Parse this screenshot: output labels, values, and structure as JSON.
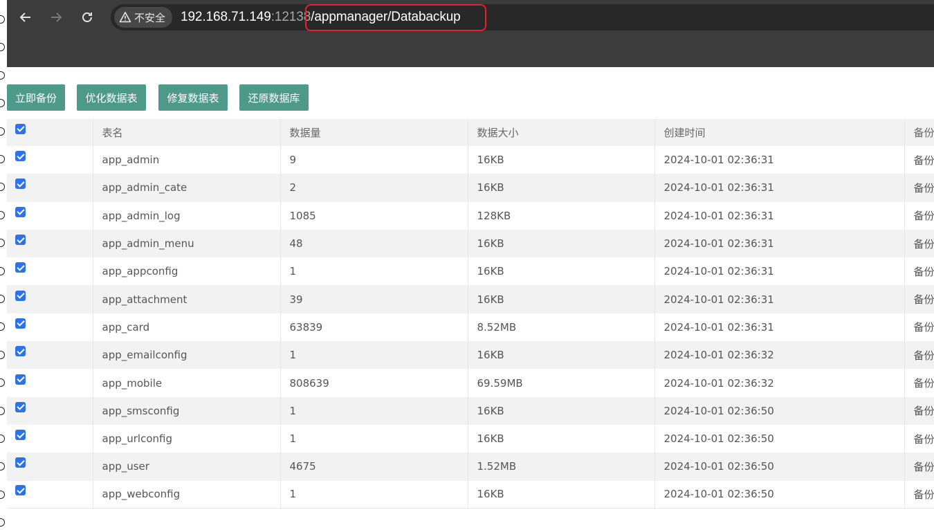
{
  "browser": {
    "security_label": "不安全",
    "url_host": "192.168.71.149",
    "url_port": ":12138",
    "url_path": "/appmanager/Databackup",
    "highlight_color": "#e8202a"
  },
  "actions": {
    "backup_now": "立即备份",
    "optimize_tables": "优化数据表",
    "repair_tables": "修复数据表",
    "restore_database": "还原数据库",
    "button_color": "#4e9a8a"
  },
  "table": {
    "headers": [
      "表名",
      "数据量",
      "数据大小",
      "创建时间",
      "备份"
    ],
    "rows": [
      {
        "name": "app_admin",
        "count": "9",
        "size": "16KB",
        "created": "2024-10-01 02:36:31",
        "op": "备份"
      },
      {
        "name": "app_admin_cate",
        "count": "2",
        "size": "16KB",
        "created": "2024-10-01 02:36:31",
        "op": "备份"
      },
      {
        "name": "app_admin_log",
        "count": "1085",
        "size": "128KB",
        "created": "2024-10-01 02:36:31",
        "op": "备份"
      },
      {
        "name": "app_admin_menu",
        "count": "48",
        "size": "16KB",
        "created": "2024-10-01 02:36:31",
        "op": "备份"
      },
      {
        "name": "app_appconfig",
        "count": "1",
        "size": "16KB",
        "created": "2024-10-01 02:36:31",
        "op": "备份"
      },
      {
        "name": "app_attachment",
        "count": "39",
        "size": "16KB",
        "created": "2024-10-01 02:36:31",
        "op": "备份"
      },
      {
        "name": "app_card",
        "count": "63839",
        "size": "8.52MB",
        "created": "2024-10-01 02:36:31",
        "op": "备份"
      },
      {
        "name": "app_emailconfig",
        "count": "1",
        "size": "16KB",
        "created": "2024-10-01 02:36:32",
        "op": "备份"
      },
      {
        "name": "app_mobile",
        "count": "808639",
        "size": "69.59MB",
        "created": "2024-10-01 02:36:32",
        "op": "备份"
      },
      {
        "name": "app_smsconfig",
        "count": "1",
        "size": "16KB",
        "created": "2024-10-01 02:36:50",
        "op": "备份"
      },
      {
        "name": "app_urlconfig",
        "count": "1",
        "size": "16KB",
        "created": "2024-10-01 02:36:50",
        "op": "备份"
      },
      {
        "name": "app_user",
        "count": "4675",
        "size": "1.52MB",
        "created": "2024-10-01 02:36:50",
        "op": "备份"
      },
      {
        "name": "app_webconfig",
        "count": "1",
        "size": "16KB",
        "created": "2024-10-01 02:36:50",
        "op": "备份"
      }
    ]
  }
}
